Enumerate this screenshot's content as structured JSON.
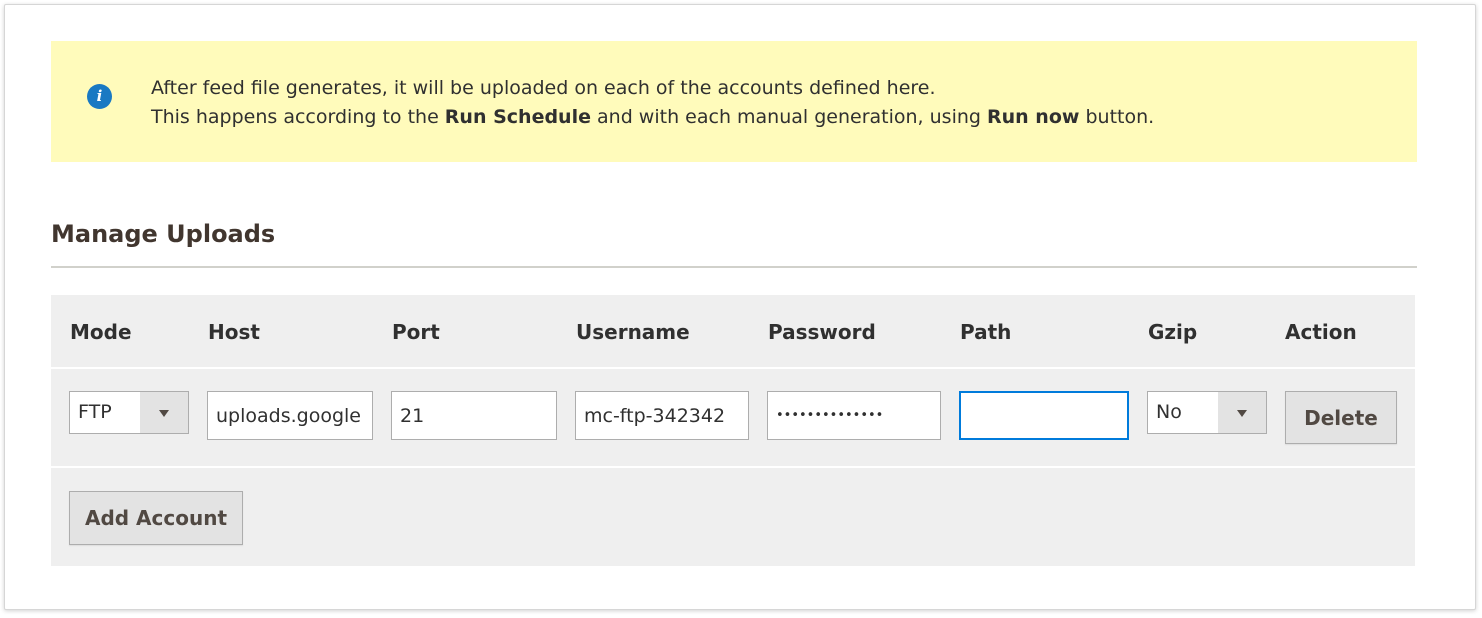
{
  "notice": {
    "icon": "info-icon",
    "line1": "After feed file generates, it will be uploaded on each of the accounts defined here.",
    "line2_prefix": "This happens according to the ",
    "line2_bold1": "Run Schedule",
    "line2_mid": " and with each manual generation, using ",
    "line2_bold2": "Run now",
    "line2_suffix": " button."
  },
  "section": {
    "title": "Manage Uploads"
  },
  "table": {
    "columns": [
      "Mode",
      "Host",
      "Port",
      "Username",
      "Password",
      "Path",
      "Gzip",
      "Action"
    ],
    "rows": [
      {
        "mode": "FTP",
        "host": "uploads.google",
        "port": "21",
        "username": "mc-ftp-342342",
        "password_masked": "••••••••••••••",
        "path": "",
        "gzip": "No",
        "delete_label": "Delete"
      }
    ],
    "add_account_label": "Add Account"
  },
  "colors": {
    "notice_bg": "#fffbbb",
    "info_icon": "#1979c3",
    "focus_border": "#007bdb",
    "grid_bg": "#efefef"
  }
}
